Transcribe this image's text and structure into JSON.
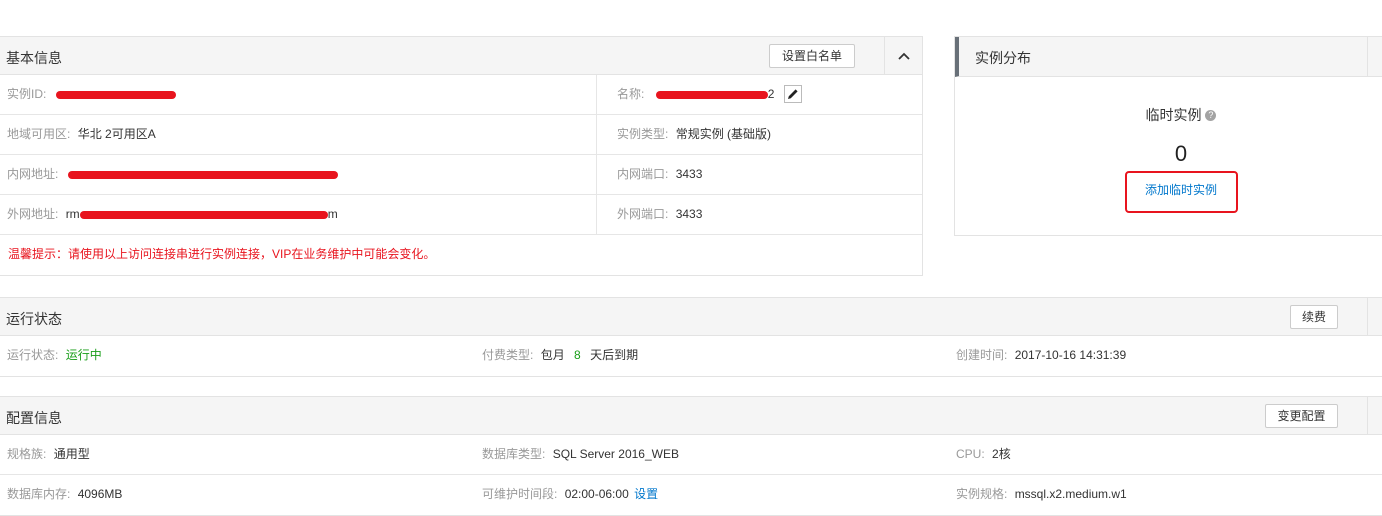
{
  "basic": {
    "title": "基本信息",
    "whitelist_button": "设置白名单",
    "collapse_icon": "chevron-up-icon",
    "instance_id_label": "实例ID:",
    "name_label": "名称:",
    "name_suffix": "2",
    "edit_icon": "pencil-icon",
    "region_label": "地域可用区:",
    "region_value": "华北 2可用区A",
    "type_label": "实例类型:",
    "type_value": "常规实例 (基础版)",
    "intranet_addr_label": "内网地址:",
    "intranet_port_label": "内网端口:",
    "intranet_port_value": "3433",
    "internet_addr_label": "外网地址:",
    "internet_addr_prefix": "rm",
    "internet_addr_suffix": "m",
    "internet_port_label": "外网端口:",
    "internet_port_value": "3433",
    "warning": "温馨提示：请使用以上访问连接串进行实例连接，VIP在业务维护中可能会变化。"
  },
  "distribution": {
    "title": "实例分布",
    "temp_label": "临时实例",
    "help_icon": "question-circle-icon",
    "temp_count": "0",
    "add_temp_link": "添加临时实例"
  },
  "status": {
    "title": "运行状态",
    "renew_button": "续费",
    "run_label": "运行状态:",
    "run_value": "运行中",
    "pay_label": "付费类型:",
    "pay_value": "包月",
    "pay_days": "8",
    "pay_suffix": "天后到期",
    "created_label": "创建时间:",
    "created_value": "2017-10-16 14:31:39"
  },
  "config": {
    "title": "配置信息",
    "change_button": "变更配置",
    "family_label": "规格族:",
    "family_value": "通用型",
    "db_type_label": "数据库类型:",
    "db_type_value": "SQL Server 2016_WEB",
    "cpu_label": "CPU:",
    "cpu_value": "2核",
    "memory_label": "数据库内存:",
    "memory_value": "4096MB",
    "maint_label": "可维护时间段:",
    "maint_value": "02:00-06:00",
    "maint_link": "设置",
    "spec_label": "实例规格:",
    "spec_value": "mssql.x2.medium.w1"
  },
  "colors": {
    "accent_link": "#0077cc",
    "running_green": "#1a9e1a",
    "warning_red": "#e8141e",
    "highlight_box": "#e8141e"
  }
}
